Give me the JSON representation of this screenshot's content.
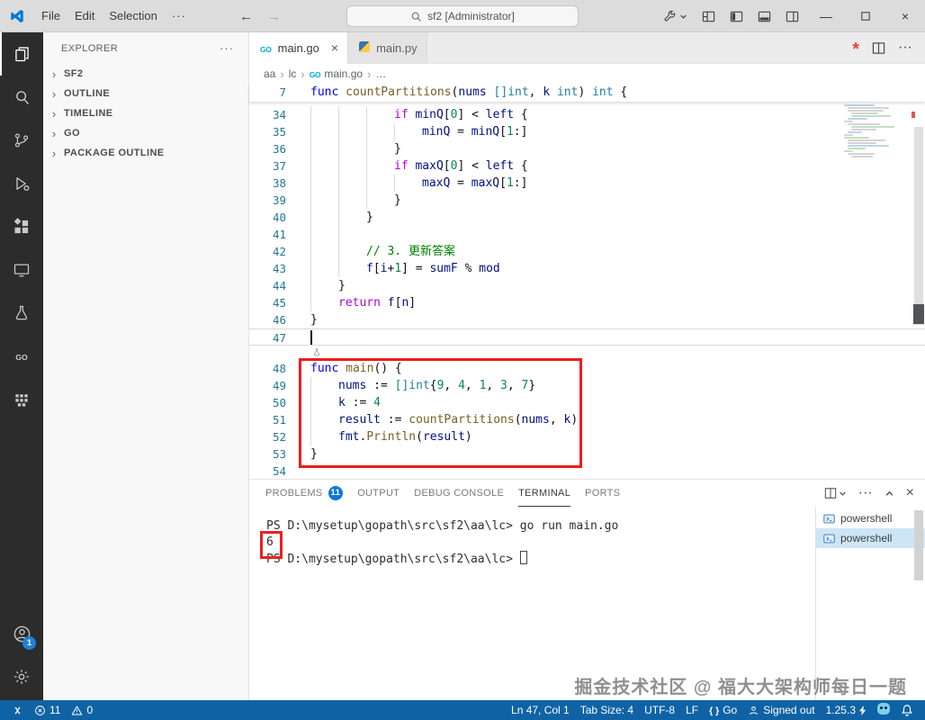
{
  "title_bar": {
    "menus": [
      "File",
      "Edit",
      "Selection"
    ],
    "overflow": "···",
    "search_text": "sf2 [Administrator]",
    "right_icons": [
      {
        "name": "configure-icon",
        "chevron": true
      },
      {
        "name": "customize-layout-icon"
      },
      {
        "name": "layout-sidebar-left-icon"
      },
      {
        "name": "layout-panel-icon"
      },
      {
        "name": "layout-sidebar-right-icon"
      }
    ],
    "window_controls": [
      {
        "name": "minimize-icon"
      },
      {
        "name": "maximize-icon"
      },
      {
        "name": "close-window-icon"
      }
    ]
  },
  "activity_bar": {
    "items": [
      {
        "icon": "explorer-icon",
        "active": true
      },
      {
        "icon": "search-icon"
      },
      {
        "icon": "source-control-icon"
      },
      {
        "icon": "run-debug-icon"
      },
      {
        "icon": "extensions-icon"
      },
      {
        "icon": "remote-explorer-icon"
      },
      {
        "icon": "testing-icon"
      },
      {
        "icon": "go-extension-icon"
      },
      {
        "icon": "containers-icon"
      }
    ],
    "bottom": [
      {
        "icon": "account-icon",
        "badge": "1"
      },
      {
        "icon": "settings-gear-icon"
      }
    ]
  },
  "sidebar": {
    "title": "EXPLORER",
    "sections": [
      {
        "label": "SF2"
      },
      {
        "label": "OUTLINE"
      },
      {
        "label": "TIMELINE"
      },
      {
        "label": "GO"
      },
      {
        "label": "PACKAGE OUTLINE"
      }
    ]
  },
  "editor": {
    "tabs": [
      {
        "label": "main.go",
        "icon": "go-file-icon",
        "active": true
      },
      {
        "label": "main.py",
        "icon": "python-file-icon"
      }
    ],
    "actions": [
      {
        "name": "asterisk-icon"
      },
      {
        "name": "split-editor-icon"
      },
      {
        "name": "more-actions-icon"
      }
    ],
    "breadcrumb": [
      {
        "label": "aa"
      },
      {
        "label": "lc"
      },
      {
        "label": "main.go",
        "icon": "go-file-icon"
      },
      {
        "label": "…"
      }
    ],
    "sticky_line": {
      "num": "7",
      "tok": [
        [
          "k",
          "func "
        ],
        [
          "f",
          "countPartitions"
        ],
        [
          "pl",
          "("
        ],
        [
          "v",
          "nums"
        ],
        [
          "pl",
          " "
        ],
        [
          "ty",
          "[]int"
        ],
        [
          "pl",
          ", "
        ],
        [
          "v",
          "k"
        ],
        [
          "pl",
          " "
        ],
        [
          "ty",
          "int"
        ],
        [
          "pl",
          ") "
        ],
        [
          "ty",
          "int"
        ],
        [
          "pl",
          " {"
        ]
      ]
    },
    "cursor_position": "Ln 47, Col 1",
    "lines": [
      {
        "num": 34,
        "ind": 3,
        "tok": [
          [
            "c",
            "if "
          ],
          [
            "v",
            "minQ"
          ],
          [
            "pl",
            "["
          ],
          [
            "no",
            "0"
          ],
          [
            "pl",
            "] < "
          ],
          [
            "v",
            "left"
          ],
          [
            "pl",
            " {"
          ]
        ]
      },
      {
        "num": 35,
        "ind": 4,
        "tok": [
          [
            "v",
            "minQ"
          ],
          [
            "pl",
            " = "
          ],
          [
            "v",
            "minQ"
          ],
          [
            "pl",
            "["
          ],
          [
            "no",
            "1"
          ],
          [
            "pl",
            ":]"
          ]
        ]
      },
      {
        "num": 36,
        "ind": 3,
        "tok": [
          [
            "pl",
            "}"
          ]
        ]
      },
      {
        "num": 37,
        "ind": 3,
        "tok": [
          [
            "c",
            "if "
          ],
          [
            "v",
            "maxQ"
          ],
          [
            "pl",
            "["
          ],
          [
            "no",
            "0"
          ],
          [
            "pl",
            "] < "
          ],
          [
            "v",
            "left"
          ],
          [
            "pl",
            " {"
          ]
        ]
      },
      {
        "num": 38,
        "ind": 4,
        "tok": [
          [
            "v",
            "maxQ"
          ],
          [
            "pl",
            " = "
          ],
          [
            "v",
            "maxQ"
          ],
          [
            "pl",
            "["
          ],
          [
            "no",
            "1"
          ],
          [
            "pl",
            ":]"
          ]
        ]
      },
      {
        "num": 39,
        "ind": 3,
        "tok": [
          [
            "pl",
            "}"
          ]
        ]
      },
      {
        "num": 40,
        "ind": 2,
        "tok": [
          [
            "pl",
            "}"
          ]
        ]
      },
      {
        "num": 41,
        "ind": 2,
        "tok": []
      },
      {
        "num": 42,
        "ind": 2,
        "tok": [
          [
            "cm",
            "// 3. 更新答案"
          ]
        ]
      },
      {
        "num": 43,
        "ind": 2,
        "tok": [
          [
            "v",
            "f"
          ],
          [
            "pl",
            "["
          ],
          [
            "v",
            "i"
          ],
          [
            "pl",
            "+"
          ],
          [
            "no",
            "1"
          ],
          [
            "pl",
            "] = "
          ],
          [
            "v",
            "sumF"
          ],
          [
            "pl",
            " % "
          ],
          [
            "v",
            "mod"
          ]
        ]
      },
      {
        "num": 44,
        "ind": 1,
        "tok": [
          [
            "pl",
            "}"
          ]
        ]
      },
      {
        "num": 45,
        "ind": 1,
        "tok": [
          [
            "c",
            "return "
          ],
          [
            "v",
            "f"
          ],
          [
            "pl",
            "["
          ],
          [
            "v",
            "n"
          ],
          [
            "pl",
            "]"
          ]
        ]
      },
      {
        "num": 46,
        "ind": 0,
        "tok": [
          [
            "pl",
            "}"
          ]
        ]
      },
      {
        "num": 47,
        "ind": 0,
        "tok": [],
        "cur": true
      },
      {
        "num": 48,
        "ind": 0,
        "tok": [
          [
            "k",
            "func "
          ],
          [
            "f",
            "main"
          ],
          [
            "pl",
            "() {"
          ]
        ],
        "gapBefore": true
      },
      {
        "num": 49,
        "ind": 1,
        "tok": [
          [
            "v",
            "nums"
          ],
          [
            "pl",
            " := "
          ],
          [
            "ty",
            "[]int"
          ],
          [
            "pl",
            "{"
          ],
          [
            "no",
            "9"
          ],
          [
            "pl",
            ", "
          ],
          [
            "no",
            "4"
          ],
          [
            "pl",
            ", "
          ],
          [
            "no",
            "1"
          ],
          [
            "pl",
            ", "
          ],
          [
            "no",
            "3"
          ],
          [
            "pl",
            ", "
          ],
          [
            "no",
            "7"
          ],
          [
            "pl",
            "}"
          ]
        ]
      },
      {
        "num": 50,
        "ind": 1,
        "tok": [
          [
            "v",
            "k"
          ],
          [
            "pl",
            " := "
          ],
          [
            "no",
            "4"
          ]
        ]
      },
      {
        "num": 51,
        "ind": 1,
        "tok": [
          [
            "v",
            "result"
          ],
          [
            "pl",
            " := "
          ],
          [
            "f",
            "countPartitions"
          ],
          [
            "pl",
            "("
          ],
          [
            "v",
            "nums"
          ],
          [
            "pl",
            ", "
          ],
          [
            "v",
            "k"
          ],
          [
            "pl",
            ")"
          ]
        ]
      },
      {
        "num": 52,
        "ind": 1,
        "tok": [
          [
            "v",
            "fmt"
          ],
          [
            "pl",
            "."
          ],
          [
            "f",
            "Println"
          ],
          [
            "pl",
            "("
          ],
          [
            "v",
            "result"
          ],
          [
            "pl",
            ")"
          ]
        ]
      },
      {
        "num": 53,
        "ind": 0,
        "tok": [
          [
            "pl",
            "}"
          ]
        ]
      },
      {
        "num": 54,
        "ind": 0,
        "tok": []
      }
    ]
  },
  "panel": {
    "tabs": [
      {
        "label": "PROBLEMS",
        "badge": "11"
      },
      {
        "label": "OUTPUT"
      },
      {
        "label": "DEBUG CONSOLE"
      },
      {
        "label": "TERMINAL",
        "active": true
      },
      {
        "label": "PORTS"
      }
    ],
    "actions": [
      {
        "name": "split-terminal-icon",
        "chevron": true
      },
      {
        "name": "more-actions-icon"
      },
      {
        "name": "maximize-panel-icon"
      },
      {
        "name": "close-panel-icon"
      }
    ],
    "terminal_lines": [
      {
        "text": "PS D:\\mysetup\\gopath\\src\\sf2\\aa\\lc> go run main.go"
      },
      {
        "text": "6",
        "boxed": true
      },
      {
        "text": "PS D:\\mysetup\\gopath\\src\\sf2\\aa\\lc> ",
        "cursor": true
      }
    ],
    "terminal_list": [
      {
        "label": "powershell"
      },
      {
        "label": "powershell",
        "selected": true
      }
    ]
  },
  "status_bar": {
    "left": [
      {
        "name": "remote-indicator",
        "icon": "remote-icon"
      },
      {
        "name": "status-errors",
        "icon": "error-icon",
        "label": "11"
      },
      {
        "name": "status-warnings",
        "icon": "warning-icon",
        "label": "0"
      }
    ],
    "right": [
      {
        "name": "status-cursor-position",
        "label": "Ln 47, Col 1"
      },
      {
        "name": "status-indentation",
        "label": "Tab Size: 4"
      },
      {
        "name": "status-encoding",
        "label": "UTF-8"
      },
      {
        "name": "status-eol",
        "label": "LF"
      },
      {
        "name": "status-language-mode",
        "icon": "braces-icon",
        "label": "Go"
      },
      {
        "name": "status-account",
        "icon": "person-icon",
        "label": "Signed out"
      },
      {
        "name": "status-go-version",
        "label": "1.25.3",
        "trailing_icon": "bolt-icon"
      },
      {
        "name": "status-gopls",
        "icon": "gopher-icon"
      },
      {
        "name": "status-notifications",
        "icon": "bell-icon"
      }
    ]
  },
  "colors": {
    "status_bg": "#0f63a5",
    "annotation_red": "#ee1d1d",
    "badge_blue": "#1177d7",
    "go_cyan": "#00acd7"
  },
  "watermark": "掘金技术社区 @ 福大大架构师每日一题"
}
